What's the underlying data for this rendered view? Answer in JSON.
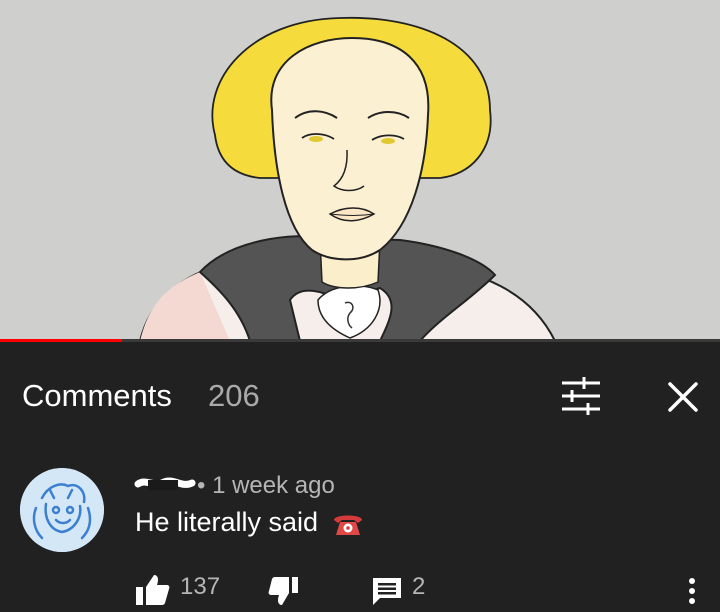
{
  "header": {
    "title": "Comments",
    "count": "206"
  },
  "video": {
    "played_fraction": 0.17
  },
  "comment": {
    "meta": "• 1 week ago",
    "text": "He literally said",
    "emoji_icon": "telephone-icon",
    "likes": "137",
    "replies": "2"
  },
  "icons": {
    "sort": "sort-filter-icon",
    "close": "close-icon",
    "like": "thumbs-up-icon",
    "dislike": "thumbs-down-icon",
    "reply": "reply-icon",
    "more": "more-vert-icon"
  },
  "colors": {
    "panel_bg": "#212121",
    "video_bg": "#cfcfcd",
    "progress": "#ff0000",
    "secondary_text": "#aaaaaa",
    "hair": "#f5dc3c"
  }
}
